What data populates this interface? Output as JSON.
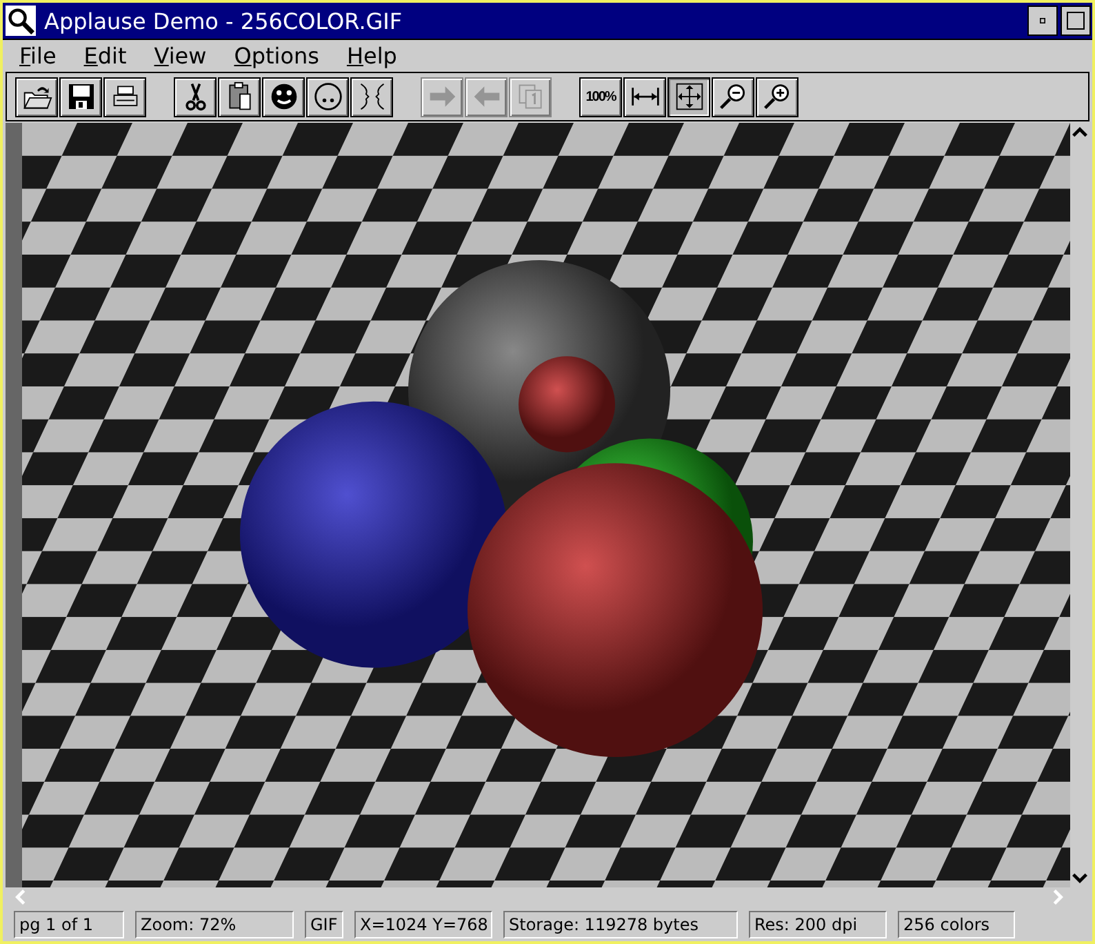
{
  "window": {
    "title": "Applause Demo - 256COLOR.GIF"
  },
  "menu": [
    {
      "label": "File"
    },
    {
      "label": "Edit"
    },
    {
      "label": "View"
    },
    {
      "label": "Options"
    },
    {
      "label": "Help"
    }
  ],
  "toolbar": {
    "groups": [
      {
        "tools": [
          {
            "kind": "open",
            "disabled": false,
            "selected": false
          },
          {
            "kind": "save",
            "disabled": false,
            "selected": false
          },
          {
            "kind": "print",
            "disabled": false,
            "selected": false
          }
        ]
      },
      {
        "tools": [
          {
            "kind": "cut",
            "disabled": false,
            "selected": false
          },
          {
            "kind": "paste",
            "disabled": false,
            "selected": false
          },
          {
            "kind": "smiley",
            "disabled": false,
            "selected": false
          },
          {
            "kind": "face",
            "disabled": false,
            "selected": false
          },
          {
            "kind": "faces",
            "disabled": false,
            "selected": false
          }
        ]
      },
      {
        "tools": [
          {
            "kind": "next",
            "disabled": true,
            "selected": false
          },
          {
            "kind": "previous",
            "disabled": true,
            "selected": false
          },
          {
            "kind": "page",
            "disabled": true,
            "selected": false
          }
        ]
      },
      {
        "tools": [
          {
            "kind": "text",
            "label": "100%",
            "disabled": false,
            "selected": false
          },
          {
            "kind": "fit-width",
            "disabled": false,
            "selected": false
          },
          {
            "kind": "fit-page",
            "disabled": false,
            "selected": true
          },
          {
            "kind": "zoom-out",
            "disabled": false,
            "selected": false
          },
          {
            "kind": "zoom-in",
            "disabled": false,
            "selected": false
          }
        ]
      }
    ]
  },
  "status_bar": [
    "pg 1 of 1",
    "Zoom: 72%",
    "GIF",
    "X=1024 Y=768",
    "Storage: 119278 bytes",
    "Res: 200 dpi",
    "256 colors"
  ]
}
